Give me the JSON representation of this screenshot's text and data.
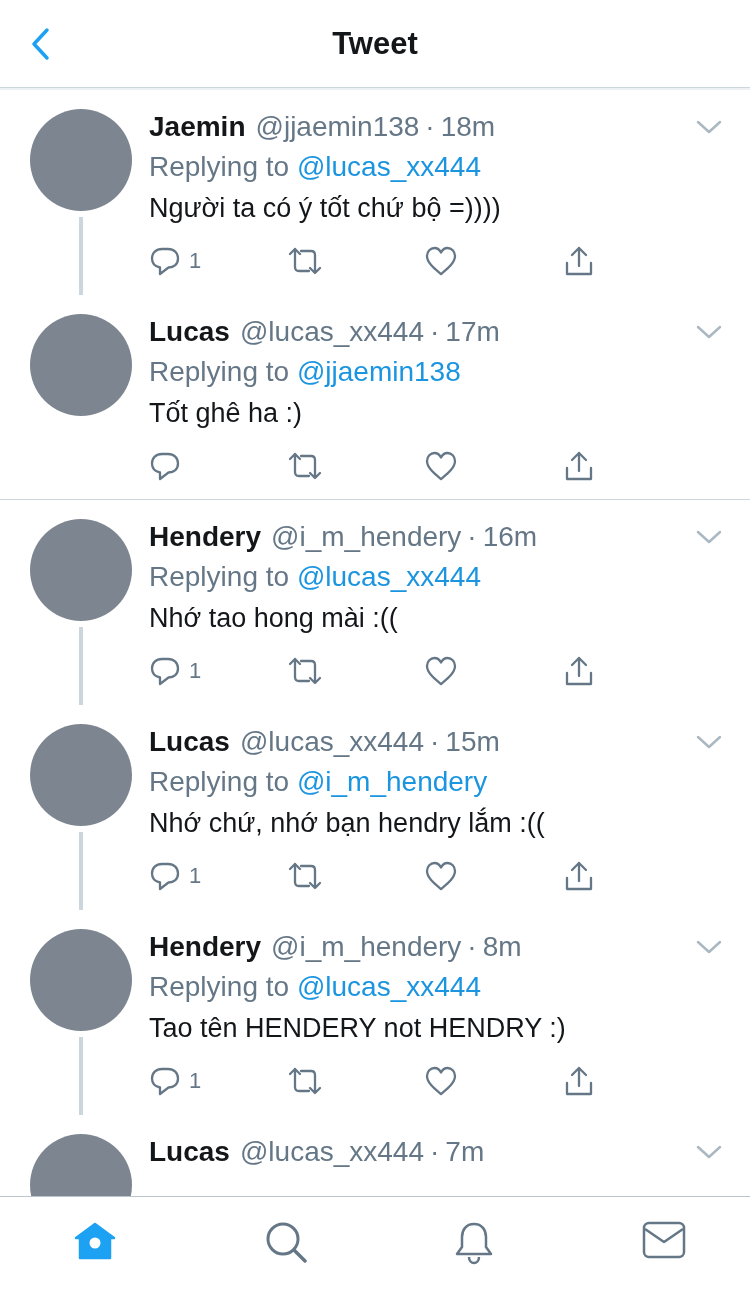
{
  "header": {
    "title": "Tweet"
  },
  "tweets": [
    {
      "name": "Jaemin",
      "handle": "@jjaemin138",
      "separator": "·",
      "time": "18m",
      "reply_label": "Replying to",
      "reply_to": "@lucas_xx444",
      "text": "Người ta có ý tốt chứ bộ =))))",
      "reply_count": "1",
      "thread_line": true,
      "divider_below": false
    },
    {
      "name": "Lucas",
      "handle": "@lucas_xx444",
      "separator": "·",
      "time": "17m",
      "reply_label": "Replying to",
      "reply_to": "@jjaemin138",
      "text": "Tốt ghê ha :)",
      "thread_line": false,
      "divider_below": true
    },
    {
      "name": "Hendery",
      "handle": "@i_m_hendery",
      "separator": "·",
      "time": "16m",
      "reply_label": "Replying to",
      "reply_to": "@lucas_xx444",
      "text": "Nhớ tao hong mài :((",
      "reply_count": "1",
      "thread_line": true,
      "divider_below": false
    },
    {
      "name": "Lucas",
      "handle": "@lucas_xx444",
      "separator": "·",
      "time": "15m",
      "reply_label": "Replying to",
      "reply_to": "@i_m_hendery",
      "text": "Nhớ chứ, nhớ bạn hendry lắm :((",
      "reply_count": "1",
      "thread_line": true,
      "divider_below": false
    },
    {
      "name": "Hendery",
      "handle": "@i_m_hendery",
      "separator": "·",
      "time": "8m",
      "reply_label": "Replying to",
      "reply_to": "@lucas_xx444",
      "text": "Tao tên HENDERY not HENDRY :)",
      "reply_count": "1",
      "thread_line": true,
      "divider_below": false
    },
    {
      "name": "Lucas",
      "handle": "@lucas_xx444",
      "separator": "·",
      "time": "7m"
    }
  ],
  "tab_bar": [
    {
      "kind": "home",
      "selected": true
    },
    {
      "kind": "search",
      "selected": false
    },
    {
      "kind": "notifications",
      "selected": false
    },
    {
      "kind": "messages",
      "selected": false
    }
  ]
}
